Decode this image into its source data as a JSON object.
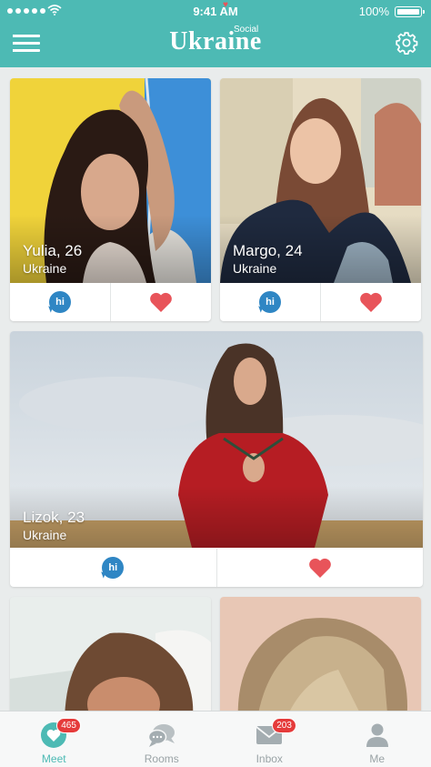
{
  "status_bar": {
    "time": "9:41 AM",
    "battery": "100%"
  },
  "header": {
    "logo_main": "Ukraine",
    "logo_sub": "Social",
    "menu_icon": "hamburger-menu-icon",
    "settings_icon": "gear-icon"
  },
  "profiles": [
    {
      "name": "Yulia, 26",
      "city": "Ukraine",
      "hi_label": "hi"
    },
    {
      "name": "Margo, 24",
      "city": "Ukraine",
      "hi_label": "hi"
    },
    {
      "name": "Lizok, 23",
      "city": "Ukraine",
      "hi_label": "hi"
    },
    {
      "name": "",
      "city": ""
    },
    {
      "name": "",
      "city": ""
    }
  ],
  "tabs": [
    {
      "label": "Meet",
      "badge": "465",
      "icon": "heart-icon",
      "active": true
    },
    {
      "label": "Rooms",
      "badge": "",
      "icon": "chat-bubbles-icon",
      "active": false
    },
    {
      "label": "Inbox",
      "badge": "203",
      "icon": "envelope-icon",
      "active": false
    },
    {
      "label": "Me",
      "badge": "",
      "icon": "person-icon",
      "active": false
    }
  ],
  "colors": {
    "brand": "#4dbab4",
    "hi_button": "#2f86c4",
    "like_heart": "#e8545a",
    "badge": "#e53b3b"
  }
}
